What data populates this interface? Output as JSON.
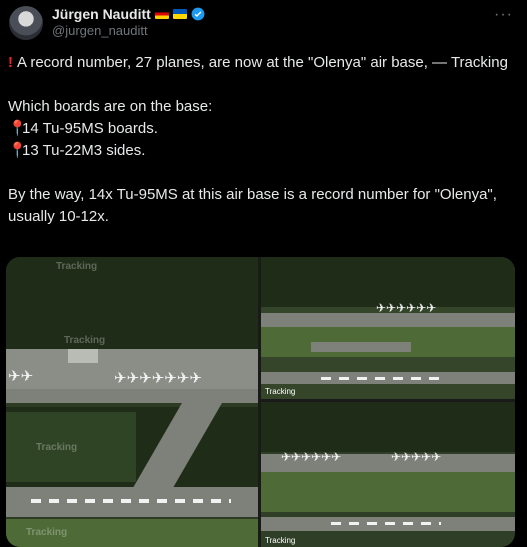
{
  "author": {
    "name": "Jürgen Nauditt",
    "handle": "@jurgen_nauditt",
    "avatar_icon": "avatar-icon"
  },
  "post": {
    "line1": "A record number, 27 planes, are now at the \"Olenya\" air base, — Tracking",
    "line2": "Which boards are on the base:",
    "line3": "14 Tu-95MS boards.",
    "line4": "13 Tu-22M3 sides.",
    "line5": "By the way, 14x Tu-95MS at this air base is a record number for \"Olenya\", usually 10-12x."
  },
  "media": {
    "watermark": "Tracking",
    "credit_tr": "Tracking",
    "credit_br": "Tracking"
  },
  "colors": {
    "accent": "#1d9bf0",
    "alert": "#f4212e",
    "muted": "#71767b"
  }
}
